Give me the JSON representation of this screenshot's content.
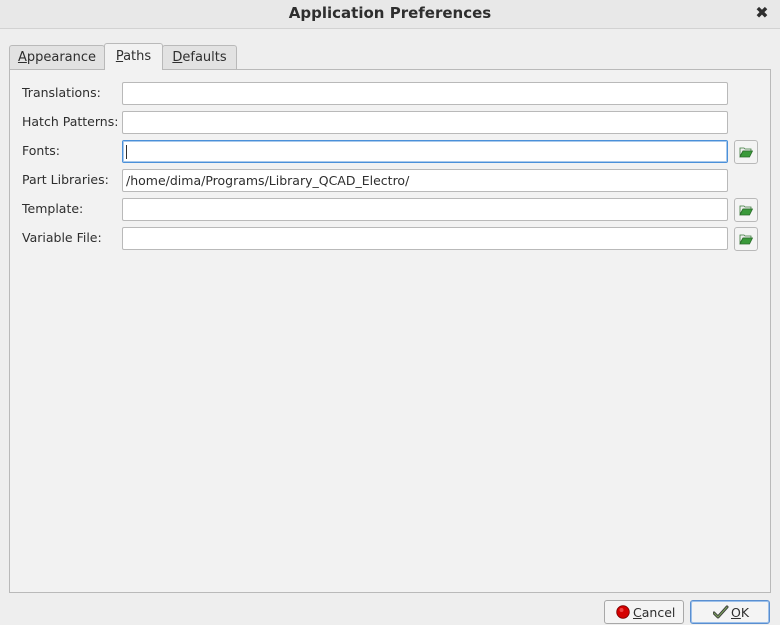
{
  "window": {
    "title": "Application Preferences"
  },
  "tabs": [
    {
      "label_first": "A",
      "label_rest": "ppearance"
    },
    {
      "label_first": "P",
      "label_rest": "aths"
    },
    {
      "label_first": "D",
      "label_rest": "efaults"
    }
  ],
  "paths": {
    "translations": {
      "label": "Translations:",
      "value": ""
    },
    "hatch_patterns": {
      "label": "Hatch Patterns:",
      "value": ""
    },
    "fonts": {
      "label": "Fonts:",
      "value": ""
    },
    "part_libraries": {
      "label": "Part Libraries:",
      "value": "/home/dima/Programs/Library_QCAD_Electro/"
    },
    "template": {
      "label": "Template:",
      "value": ""
    },
    "variable_file": {
      "label": "Variable File:",
      "value": ""
    }
  },
  "buttons": {
    "cancel": {
      "acc": "C",
      "rest": "ancel"
    },
    "ok": {
      "acc": "O",
      "rest": "K"
    }
  },
  "icons": {
    "close": "close-icon",
    "browse": "folder-open-icon",
    "cancel": "cancel-icon",
    "ok": "checkmark-icon"
  },
  "colors": {
    "folder": "#3a9a3a",
    "cancel": "#d40000"
  }
}
